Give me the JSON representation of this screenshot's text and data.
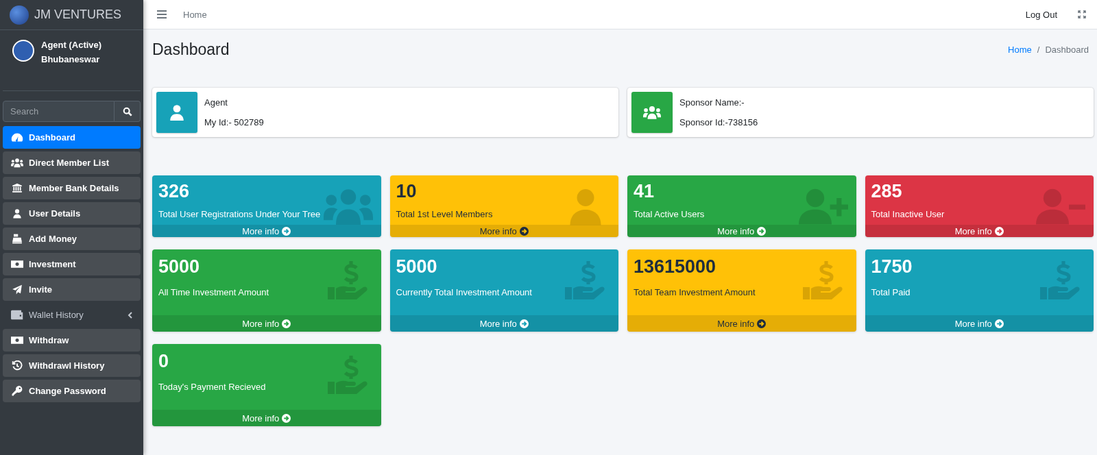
{
  "brand": {
    "name": "JM VENTURES"
  },
  "user_panel": {
    "role": "Agent (Active)",
    "location": "Bhubaneswar"
  },
  "search": {
    "placeholder": "Search"
  },
  "sidebar": {
    "items": [
      {
        "label": "Dashboard",
        "kind": "link",
        "selected": true
      },
      {
        "label": "Direct Member List",
        "kind": "link",
        "selected": false
      },
      {
        "label": "Member Bank Details",
        "kind": "link",
        "selected": false
      },
      {
        "label": "User Details",
        "kind": "link",
        "selected": false
      },
      {
        "label": "Add Money",
        "kind": "link",
        "selected": false
      },
      {
        "label": "Investment",
        "kind": "link",
        "selected": false
      },
      {
        "label": "Invite",
        "kind": "link",
        "selected": false
      },
      {
        "label": "Wallet History",
        "kind": "tree",
        "selected": false
      },
      {
        "label": "Withdraw",
        "kind": "link",
        "selected": false
      },
      {
        "label": "Withdrawl History",
        "kind": "link",
        "selected": false
      },
      {
        "label": "Change Password",
        "kind": "link",
        "selected": false
      }
    ]
  },
  "topbar": {
    "home_link": "Home",
    "logout": "Log Out"
  },
  "page": {
    "title": "Dashboard",
    "breadcrumb": [
      {
        "label": "Home",
        "kind": "link"
      },
      {
        "label": "/",
        "kind": "separator"
      },
      {
        "label": "Dashboard",
        "kind": "current"
      }
    ]
  },
  "profile_boxes": [
    {
      "color": "#17a2b8",
      "lines": [
        "Agent",
        "My Id:- 502789"
      ]
    },
    {
      "color": "#28a745",
      "lines": [
        "Sponsor Name:-",
        "Sponsor Id:-738156"
      ]
    }
  ],
  "stat_boxes": [
    {
      "value": "326",
      "label": "Total User Registrations Under Your Tree",
      "color": "#17a2b8",
      "link": "More info"
    },
    {
      "value": "10",
      "label": "Total 1st Level Members",
      "color": "#ffc107",
      "link": "More info"
    },
    {
      "value": "41",
      "label": "Total Active Users",
      "color": "#28a745",
      "link": "More info"
    },
    {
      "value": "285",
      "label": "Total Inactive User",
      "color": "#dc3545",
      "link": "More info"
    },
    {
      "value": "5000",
      "label": "All Time Investment Amount",
      "color": "#28a745",
      "link": "More info"
    },
    {
      "value": "5000",
      "label": "Currently Total Investment Amount",
      "color": "#17a2b8",
      "link": "More info"
    },
    {
      "value": "13615000",
      "label": "Total Team Investment Amount",
      "color": "#ffc107",
      "link": "More info"
    },
    {
      "value": "1750",
      "label": "Total Paid",
      "color": "#17a2b8",
      "link": "More info"
    },
    {
      "value": "0",
      "label": "Today's Payment Recieved",
      "color": "#28a745",
      "link": "More info"
    }
  ]
}
